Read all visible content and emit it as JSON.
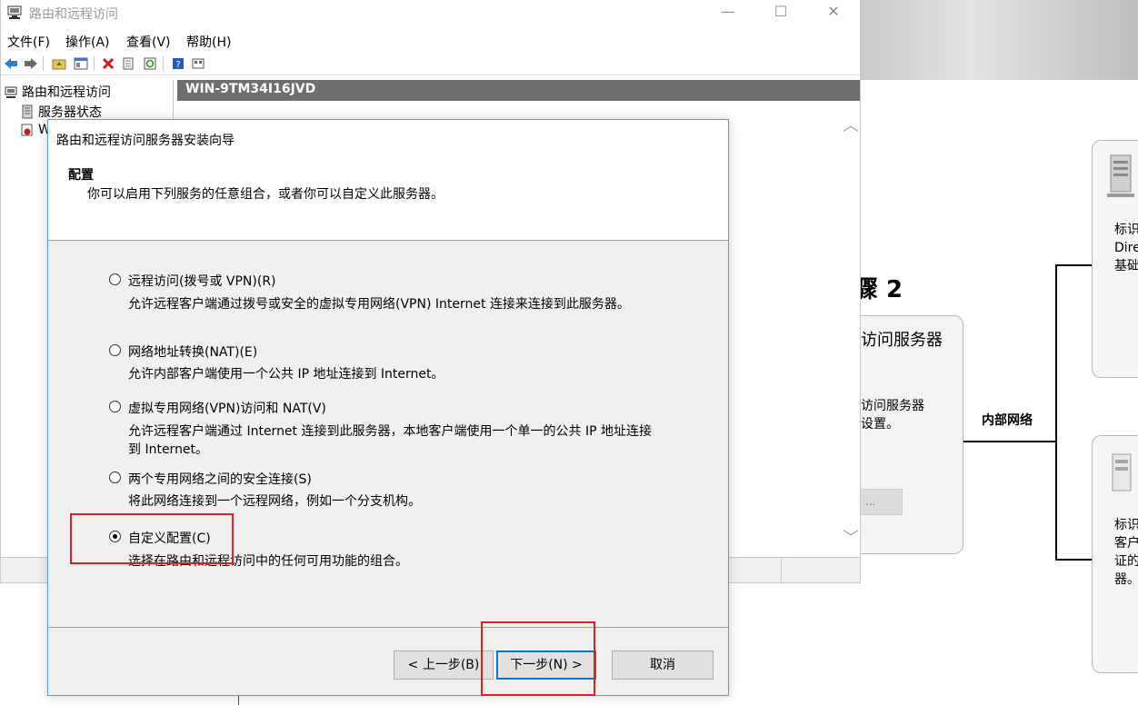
{
  "background_page": {
    "heading_fragment": "骤 2",
    "card_center": {
      "title_fragment": "访问服务器",
      "line1": "访问服务器",
      "line2": "设置。",
      "button_fragment": "..."
    },
    "internal_network_label": "内部网络",
    "card_right_top": {
      "lines": [
        "标识",
        "Dire",
        "基础"
      ]
    },
    "card_right_bottom": {
      "lines": [
        "标识",
        "客户",
        "证的",
        "器。"
      ]
    }
  },
  "mmc": {
    "title": "路由和远程访问",
    "caption": {
      "minimize": "—",
      "maximize": "☐",
      "close": "✕"
    },
    "menu": {
      "file": "文件(F)",
      "action": "操作(A)",
      "view": "查看(V)",
      "help": "帮助(H)"
    },
    "tree": {
      "root": "路由和远程访问",
      "server_status": "服务器状态",
      "server_fragment": "W"
    },
    "content_header": "WIN-9TM34I16JVD",
    "scroll": {
      "up": "︿",
      "down": "﹀"
    }
  },
  "wizard": {
    "title": "路由和远程访问服务器安装向导",
    "header_title": "配置",
    "header_subtitle": "你可以启用下列服务的任意组合，或者你可以自定义此服务器。",
    "options": [
      {
        "label": "远程访问(拨号或 VPN)(R)",
        "desc": [
          "允许远程客户端通过拨号或安全的虚拟专用网络(VPN) Internet 连接来连接到此服务器。"
        ],
        "checked": false
      },
      {
        "label": "网络地址转换(NAT)(E)",
        "desc": [
          "允许内部客户端使用一个公共 IP 地址连接到 Internet。"
        ],
        "checked": false
      },
      {
        "label": "虚拟专用网络(VPN)访问和 NAT(V)",
        "desc": [
          "允许远程客户端通过 Internet 连接到此服务器，本地客户端使用一个单一的公共 IP 地址连接",
          "到 Internet。"
        ],
        "checked": false
      },
      {
        "label": "两个专用网络之间的安全连接(S)",
        "desc": [
          "将此网络连接到一个远程网络，例如一个分支机构。"
        ],
        "checked": false
      },
      {
        "label": "自定义配置(C)",
        "desc": [
          "选择在路由和远程访问中的任何可用功能的组合。"
        ],
        "checked": true
      }
    ],
    "buttons": {
      "back": "< 上一步(B)",
      "next": "下一步(N) >",
      "cancel": "取消"
    }
  },
  "colors": {
    "highlight": "#e02020",
    "dialog_border": "#5b9bd5",
    "content_header_bg": "#6e6e6e",
    "default_button_border": "#0078d7"
  }
}
